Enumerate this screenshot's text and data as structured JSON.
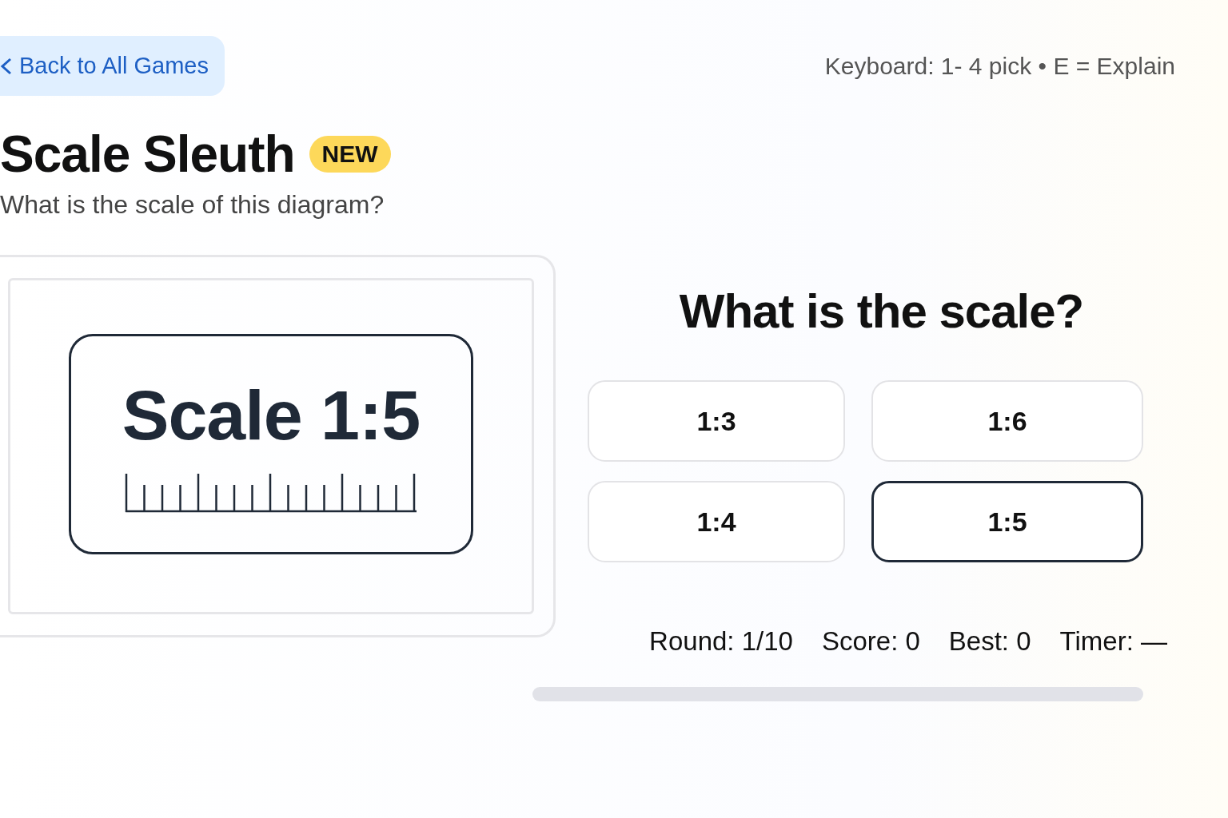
{
  "back_link": {
    "label": "Back to All Games"
  },
  "keyboard_hint": "Keyboard: 1- 4 pick • E = Explain",
  "title": "Scale Sleuth",
  "badge": "NEW",
  "subtitle": "What is the scale of this diagram?",
  "diagram": {
    "label": "Scale 1:5"
  },
  "question": "What is the scale?",
  "options": [
    {
      "label": "1:3",
      "selected": false
    },
    {
      "label": "1:6",
      "selected": false
    },
    {
      "label": "1:4",
      "selected": false
    },
    {
      "label": "1:5",
      "selected": true
    }
  ],
  "stats": [
    "Round: 1/10",
    "Score: 0",
    "Best: 0",
    "Timer: —"
  ],
  "progress": {
    "level": 0
  }
}
